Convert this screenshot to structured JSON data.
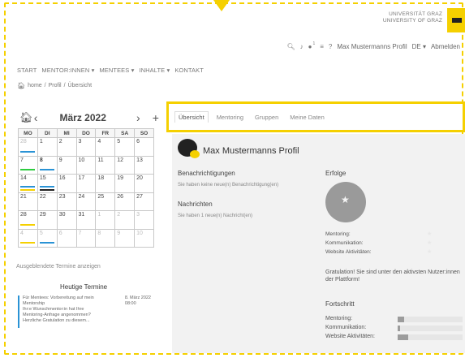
{
  "university": {
    "line1": "UNIVERSITÄT GRAZ",
    "line2": "UNIVERSITY OF GRAZ"
  },
  "topbar": {
    "notif_count": "1",
    "username": "Max Mustermanns Profil",
    "lang": "DE ▾",
    "logout": "Abmelden"
  },
  "nav": [
    "START",
    "MENTOR:INNEN ▾",
    "MENTEES ▾",
    "INHALTE ▾",
    "KONTAKT"
  ],
  "breadcrumb": [
    "home",
    "/",
    "Profil",
    "/",
    "Übersicht"
  ],
  "calendar": {
    "month": "März 2022",
    "weekdays": [
      "MO",
      "DI",
      "MI",
      "DO",
      "FR",
      "SA",
      "SO"
    ],
    "weeks": [
      [
        "28",
        "1",
        "2",
        "3",
        "4",
        "5",
        "6"
      ],
      [
        "7",
        "8",
        "9",
        "10",
        "11",
        "12",
        "13"
      ],
      [
        "14",
        "15",
        "16",
        "17",
        "18",
        "19",
        "20"
      ],
      [
        "21",
        "22",
        "23",
        "24",
        "25",
        "26",
        "27"
      ],
      [
        "28",
        "29",
        "30",
        "31",
        "1",
        "2",
        "3"
      ],
      [
        "4",
        "5",
        "6",
        "7",
        "8",
        "9",
        "10"
      ]
    ],
    "show_hidden": "Ausgeblendete Termine anzeigen"
  },
  "today": {
    "title": "Heutige Termine",
    "line1": "Für Mentees: Vorbereitung auf mein",
    "line2": "Mentorship",
    "line3": "Ihr:e Wunschmentor:in hat Ihre",
    "line4": "Mentoring-Anfrage angenommen?",
    "line5": "Herzliche Gratulation zu diesem...",
    "date": "8. März 2022",
    "time": "08:00"
  },
  "tabs": [
    "Übersicht",
    "Mentoring",
    "Gruppen",
    "Meine Daten"
  ],
  "profile": {
    "title": "Max Mustermanns Profil",
    "notifications_heading": "Benachrichtigungen",
    "notifications_text": "Sie haben keine neue(n) Benachrichtigung(en)",
    "messages_heading": "Nachrichten",
    "messages_text": "Sie haben 1 neue(n) Nachricht(en)",
    "success_heading": "Erfolge",
    "stats": [
      "Mentoring:",
      "Kommunikation:",
      "Website Aktivitäten:"
    ],
    "congrats": "Gratulation! Sie sind unter den aktivsten Nutzer:innen der Plattform!",
    "progress_heading": "Fortschritt",
    "progress": [
      {
        "label": "Mentoring:",
        "value": 0.1
      },
      {
        "label": "Kommunikation:",
        "value": 0.04
      },
      {
        "label": "Website Aktivitäten:",
        "value": 0.16
      }
    ]
  },
  "colors": {
    "accent": "#f5d000",
    "blue": "#2a93d5",
    "green": "#2ecc40",
    "dark": "#222222"
  }
}
